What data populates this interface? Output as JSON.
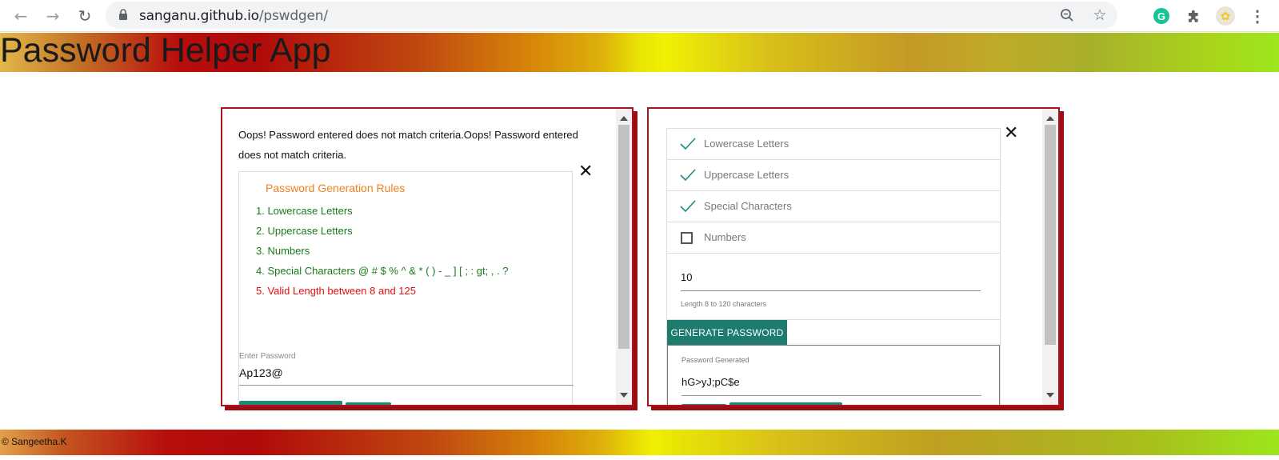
{
  "browser": {
    "url_host": "sanganu.github.io",
    "url_path": "/pswdgen/"
  },
  "app": {
    "title": "Password Helper App"
  },
  "validator": {
    "error_message": "Oops! Password entered does not match criteria.Oops! Password entered does not match criteria.",
    "rules_title": "Password Generation Rules",
    "rules": [
      {
        "text": "1. Lowercase Letters",
        "status": "ok"
      },
      {
        "text": "2. Uppercase Letters",
        "status": "ok"
      },
      {
        "text": "3. Numbers",
        "status": "ok"
      },
      {
        "text": "4. Special Characters @ # $ % ^ & * ( ) - _ ] [ ; : gt; , . ?",
        "status": "ok"
      },
      {
        "text": "5. Valid Length between 8 and 125",
        "status": "bad"
      }
    ],
    "password_label": "Enter Password",
    "password_value": "Ap123@",
    "close_symbol": "✕"
  },
  "generator": {
    "options": [
      {
        "label": "Lowercase Letters",
        "checked": true
      },
      {
        "label": "Uppercase Letters",
        "checked": true
      },
      {
        "label": "Special Characters",
        "checked": true
      },
      {
        "label": "Numbers",
        "checked": false
      }
    ],
    "length_value": "10",
    "length_hint": "Length 8 to 120 characters",
    "generate_label": "GENERATE PASSWORD",
    "generated_label": "Password Generated",
    "generated_value": "hG>yJ;pC$e",
    "close_symbol": "✕"
  },
  "footer": {
    "text": "© Sangeetha.K"
  },
  "colors": {
    "panel_border": "#b0101a",
    "button": "#1e7c6e",
    "rule_ok": "#1a7a1a",
    "rule_bad": "#e01010",
    "rules_title": "#f08020"
  }
}
